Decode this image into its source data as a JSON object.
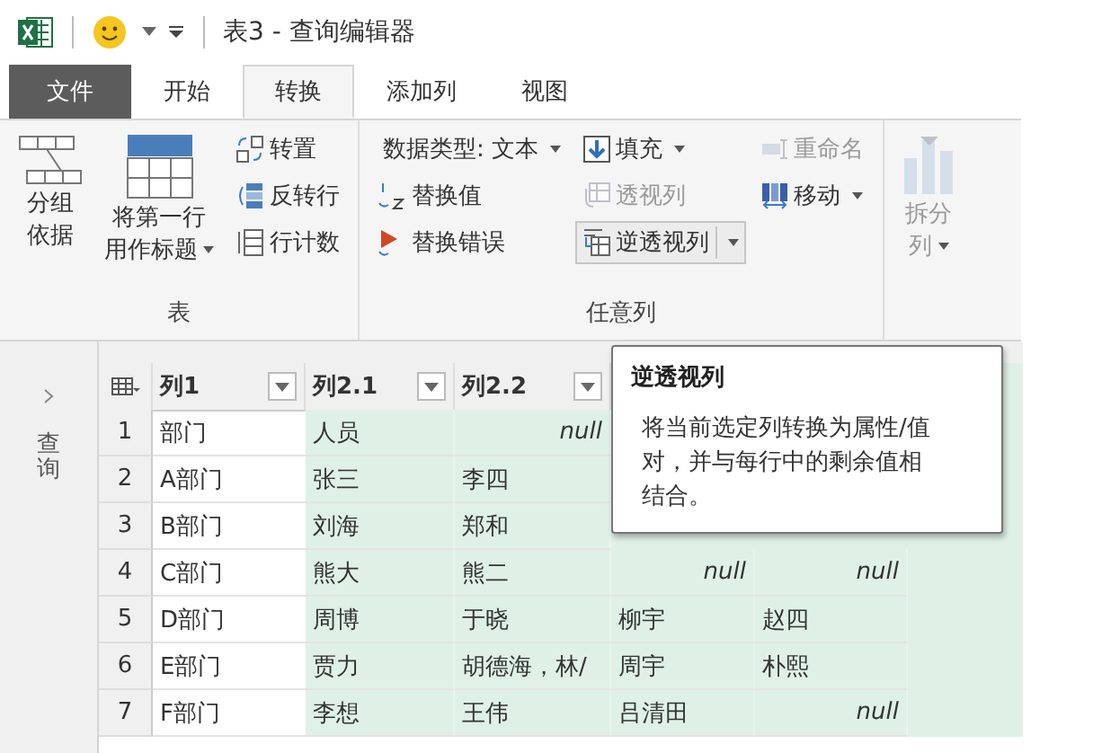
{
  "window": {
    "title": "表3 - 查询编辑器"
  },
  "tabs": [
    {
      "label": "文件",
      "kind": "file",
      "selected": false
    },
    {
      "label": "开始",
      "kind": "tab",
      "selected": false
    },
    {
      "label": "转换",
      "kind": "tab",
      "selected": true
    },
    {
      "label": "添加列",
      "kind": "tab",
      "selected": false
    },
    {
      "label": "视图",
      "kind": "tab",
      "selected": false
    }
  ],
  "ribbon": {
    "groups": [
      {
        "label": "表",
        "columns": [
          [
            {
              "kind": "large",
              "lines": [
                "分组",
                "依据"
              ]
            }
          ],
          [
            {
              "kind": "large",
              "lines": [
                "将第一行",
                "用作标题"
              ],
              "dropdown": true
            }
          ],
          [
            {
              "kind": "small",
              "label": "转置"
            },
            {
              "kind": "small",
              "label": "反转行"
            },
            {
              "kind": "small",
              "label": "行计数"
            }
          ]
        ]
      },
      {
        "label": "任意列",
        "columns": [
          [
            {
              "kind": "small",
              "label": "数据类型: 文本",
              "dropdown": true
            },
            {
              "kind": "small",
              "label": "替换值"
            },
            {
              "kind": "small",
              "label": "替换错误"
            }
          ],
          [
            {
              "kind": "small",
              "label": "填充",
              "dropdown": true
            },
            {
              "kind": "small",
              "label": "透视列",
              "disabled": true
            },
            {
              "kind": "small",
              "label": "逆透视列",
              "dropdown": true,
              "highlighted": true
            }
          ],
          [
            {
              "kind": "small",
              "label": "重命名",
              "disabled": true
            },
            {
              "kind": "small",
              "label": "移动",
              "dropdown": true
            }
          ]
        ]
      },
      {
        "columns": [
          [
            {
              "kind": "large",
              "lines": [
                "拆分",
                "列"
              ],
              "dropdown": true,
              "disabled": true
            }
          ]
        ]
      }
    ]
  },
  "sidebar": {
    "label": "查询"
  },
  "table": {
    "columns": [
      {
        "label": "列1"
      },
      {
        "label": "列2.1"
      },
      {
        "label": "列2.2"
      }
    ],
    "rows": [
      {
        "number": "1",
        "cells": [
          "部门",
          "人员",
          {
            "text": "null",
            "kind": "null"
          },
          null,
          null
        ]
      },
      {
        "number": "2",
        "cells": [
          "A部门",
          "张三",
          "李四",
          null,
          null
        ]
      },
      {
        "number": "3",
        "cells": [
          "B部门",
          "刘海",
          "郑和",
          null,
          null
        ]
      },
      {
        "number": "4",
        "cells": [
          "C部门",
          "熊大",
          "熊二",
          {
            "text": "null",
            "kind": "null"
          },
          {
            "text": "null",
            "kind": "null"
          }
        ]
      },
      {
        "number": "5",
        "cells": [
          "D部门",
          "周博",
          "于晓",
          "柳宇",
          "赵四"
        ]
      },
      {
        "number": "6",
        "cells": [
          "E部门",
          "贾力",
          "胡德海，林/",
          "周宇",
          "朴熙"
        ]
      },
      {
        "number": "7",
        "cells": [
          "F部门",
          "李想",
          "王伟",
          "吕清田",
          {
            "text": "null",
            "kind": "null"
          }
        ]
      }
    ]
  },
  "tooltip": {
    "title": "逆透视列",
    "text": "将当前选定列转换为属性/值对，并与每行中的剩余值相结合。"
  }
}
